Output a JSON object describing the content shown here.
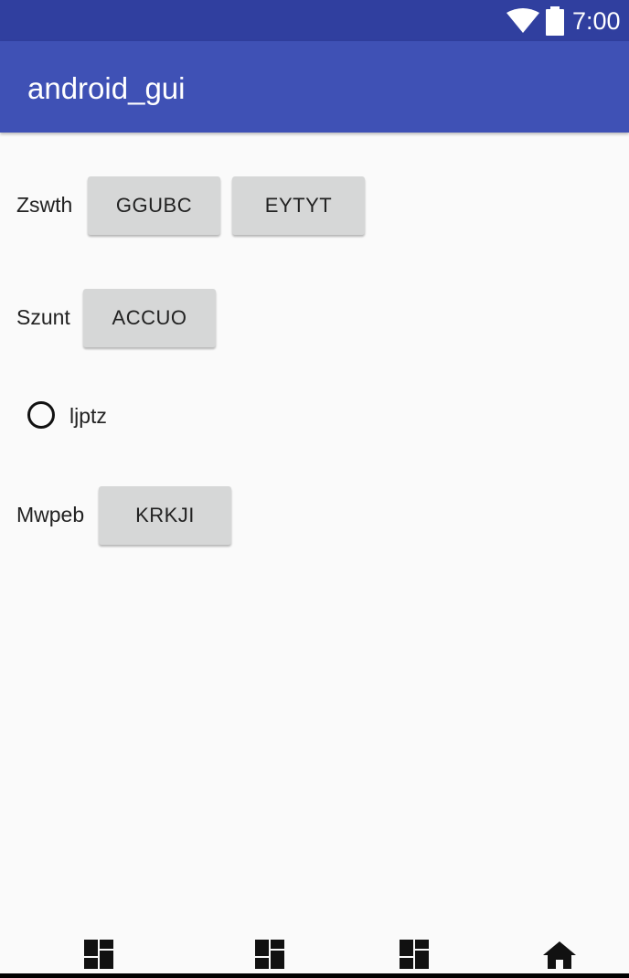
{
  "status_bar": {
    "time": "7:00",
    "wifi_icon": "wifi-icon",
    "battery_icon": "battery-icon"
  },
  "app_bar": {
    "title": "android_gui"
  },
  "rows": [
    {
      "label": "Zswth",
      "buttons": [
        "GGUBC",
        "EYTYT"
      ]
    },
    {
      "label": "Szunt",
      "buttons": [
        "ACCUO"
      ]
    },
    {
      "radio": {
        "label": "ljptz",
        "checked": false
      }
    },
    {
      "label": "Mwpeb",
      "buttons": [
        "KRKJI"
      ]
    }
  ],
  "nav_bar": {
    "icons": [
      "dashboard-icon",
      "dashboard-icon",
      "dashboard-icon",
      "home-icon"
    ]
  }
}
